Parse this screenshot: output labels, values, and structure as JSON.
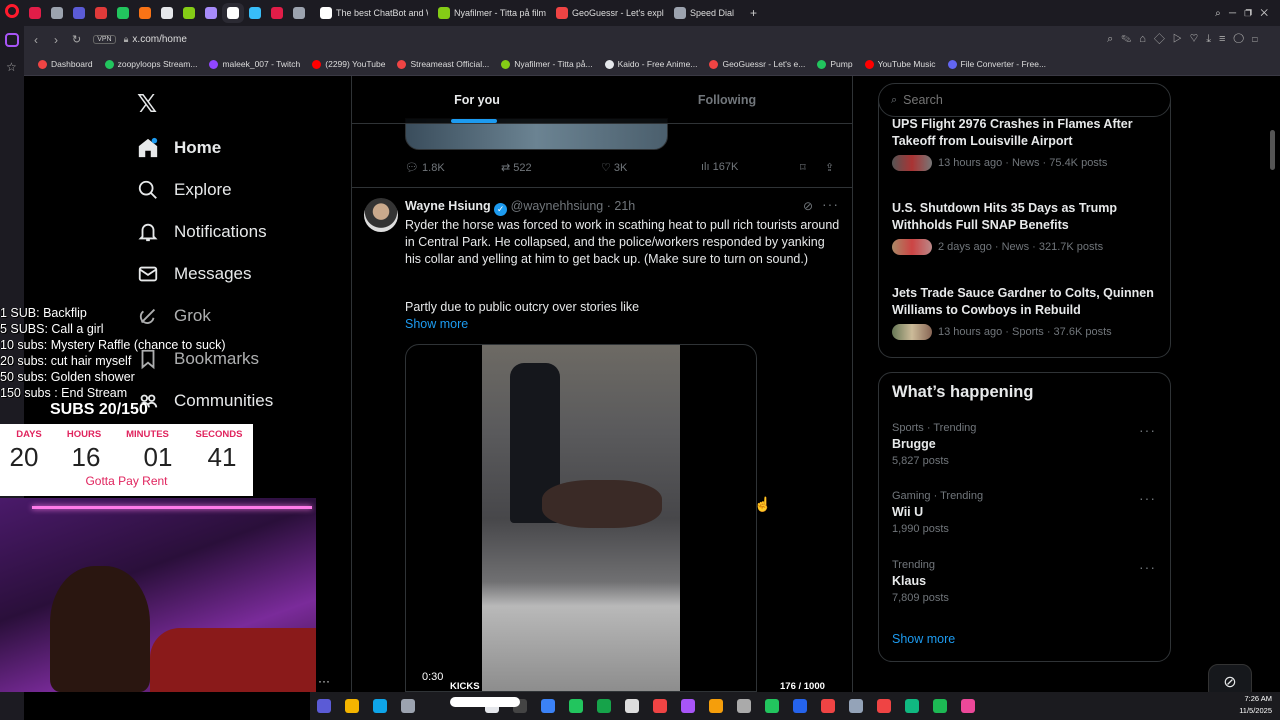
{
  "browser": {
    "tabs": [
      {
        "label": "",
        "color": "#e11d48"
      },
      {
        "label": "",
        "color": "#9ca3af"
      },
      {
        "label": "",
        "color": "#5b5bd6"
      },
      {
        "label": "",
        "color": "#e03a3a"
      },
      {
        "label": "",
        "color": "#22c55e"
      },
      {
        "label": "",
        "color": "#f97316"
      },
      {
        "label": "",
        "color": "#e5e7eb"
      },
      {
        "label": "",
        "color": "#84cc16"
      },
      {
        "label": "",
        "color": "#a78bfa"
      },
      {
        "label": "",
        "color": "#ffffff"
      },
      {
        "label": "",
        "color": "#38bdf8"
      },
      {
        "label": "",
        "color": "#e11d48"
      },
      {
        "label": "",
        "color": "#9ca3af"
      },
      {
        "label": "The best ChatBot and Wic",
        "color": "#ffffff"
      },
      {
        "label": "Nyafilmer - Titta på filmer",
        "color": "#84cc16"
      },
      {
        "label": "GeoGuessr - Let's explore",
        "color": "#ef4444"
      },
      {
        "label": "Speed Dial",
        "color": "#9ca3af"
      }
    ],
    "vpn_label": "VPN",
    "url": "x.com/home",
    "bookmarks": [
      {
        "label": "Dashboard",
        "color": "#ef4444"
      },
      {
        "label": "zoopyloops Stream...",
        "color": "#22c55e"
      },
      {
        "label": "maleek_007 - Twitch",
        "color": "#9146ff"
      },
      {
        "label": "(2299) YouTube",
        "color": "#ff0000"
      },
      {
        "label": "Streameast Official...",
        "color": "#ef4444"
      },
      {
        "label": "Nyafilmer - Titta på...",
        "color": "#84cc16"
      },
      {
        "label": "Kaido - Free Anime...",
        "color": "#e5e7eb"
      },
      {
        "label": "GeoGuessr - Let's e...",
        "color": "#ef4444"
      },
      {
        "label": "Pump",
        "color": "#22c55e"
      },
      {
        "label": "YouTube Music",
        "color": "#ff0000"
      },
      {
        "label": "File Converter - Free...",
        "color": "#6366f1"
      }
    ]
  },
  "nav": {
    "home": "Home",
    "explore": "Explore",
    "notifications": "Notifications",
    "messages": "Messages",
    "grok": "Grok",
    "bookmarks": "Bookmarks",
    "communities": "Communities"
  },
  "feed": {
    "tab_for_you": "For you",
    "tab_following": "Following",
    "prev_actions": {
      "replies": "1.8K",
      "reposts": "522",
      "likes": "3K",
      "views": "167K"
    },
    "post": {
      "author": "Wayne Hsiung",
      "handle": "@waynehhsiung",
      "time": "· 21h",
      "text": "Ryder the horse was forced to work in scathing heat to pull rich tourists around in Central Park. He collapsed, and the police/workers responded by yanking his collar and yelling at him to get back up. (Make sure to turn on sound.)",
      "text2": "Partly due to public outcry over stories like",
      "show_more": "Show more",
      "video_time": "0:30"
    }
  },
  "search": {
    "placeholder": "Search"
  },
  "news": [
    {
      "title": "UPS Flight 2976 Crashes in Flames After Takeoff from Louisville Airport",
      "meta": "13 hours ago · News · 75.4K posts"
    },
    {
      "title": "U.S. Shutdown Hits 35 Days as Trump Withholds Full SNAP Benefits",
      "meta": "2 days ago · News · 321.7K posts"
    },
    {
      "title": "Jets Trade Sauce Gardner to Colts, Quinnen Williams to Cowboys in Rebuild",
      "meta": "13 hours ago · Sports · 37.6K posts"
    }
  ],
  "happening": {
    "title": "What’s happening",
    "items": [
      {
        "context": "Sports · Trending",
        "name": "Brugge",
        "posts": "5,827 posts"
      },
      {
        "context": "Gaming · Trending",
        "name": "Wii U",
        "posts": "1,990 posts"
      },
      {
        "context": "Trending",
        "name": "Klaus",
        "posts": "7,809 posts"
      }
    ],
    "show_more": "Show more"
  },
  "stream_overlay": {
    "goals": [
      "1 SUB: Backflip",
      "5 SUBS: Call a girl",
      "10 subs: Mystery Raffle (chance to suck)",
      "20 subs: cut hair myself",
      "50 subs: Golden shower",
      "150 subs : End Stream"
    ],
    "subs": "SUBS 20/150",
    "timer_labels": [
      "DAYS",
      "HOURS",
      "MINUTES",
      "SECONDS"
    ],
    "timer_values": [
      "20",
      "16",
      "01",
      "41"
    ],
    "timer_caption": "Gotta Pay Rent",
    "kicks_label": "KICKS",
    "kicks_count": "176 / 1000"
  },
  "system": {
    "time": "7:26 AM",
    "date": "11/5/2025"
  }
}
